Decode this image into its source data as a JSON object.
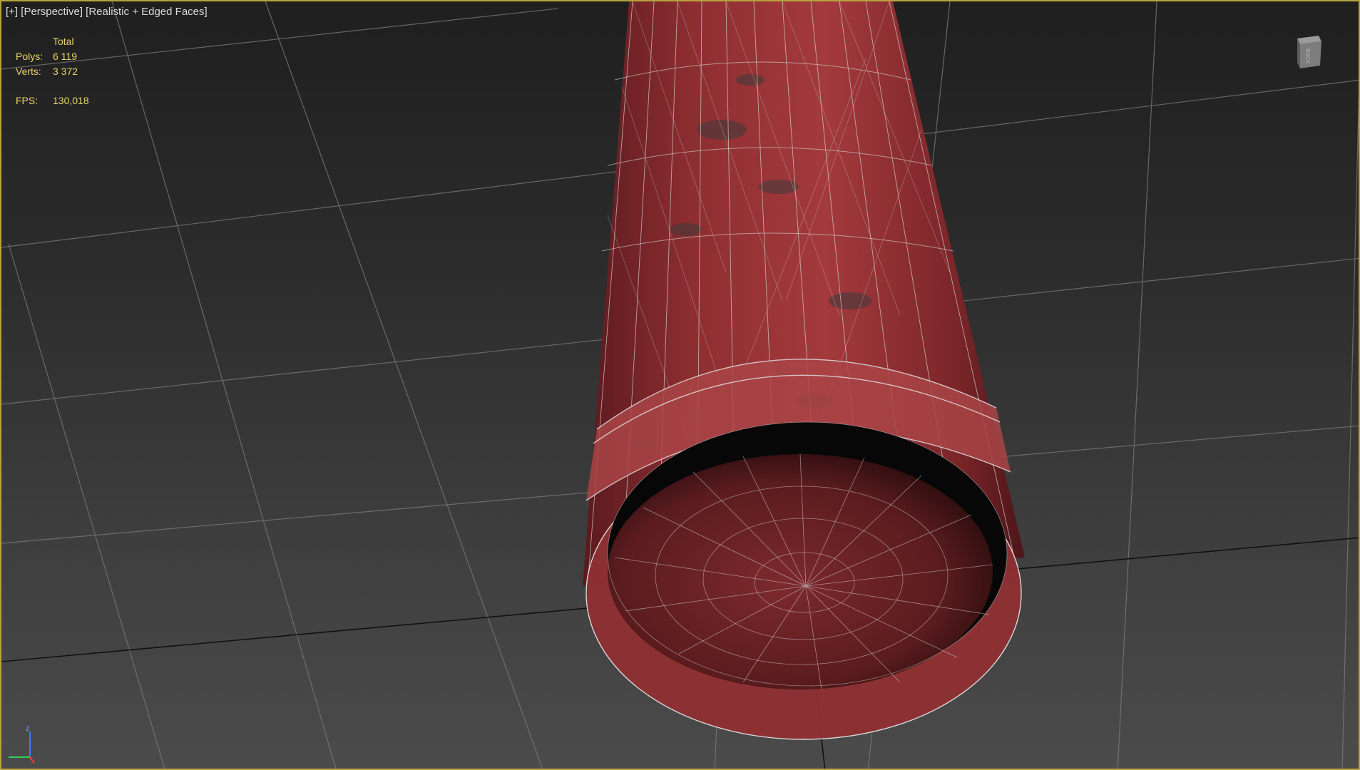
{
  "viewport": {
    "menu_plus": "[+]",
    "view_name": "[Perspective]",
    "shading_mode": "[Realistic + Edged Faces]",
    "border_color": "#b8a23c"
  },
  "stats": {
    "header": "Total",
    "polys_label": "Polys:",
    "polys_value": "6 119",
    "verts_label": "Verts:",
    "verts_value": "3 372",
    "fps_label": "FPS:",
    "fps_value": "130,018",
    "text_color": "#e8d36a"
  },
  "navigation": {
    "viewcube_icon": "viewcube-icon",
    "axis_icon": "axis-tripod-icon",
    "axis_z_label": "z"
  },
  "object": {
    "name_hint": "red cylinder",
    "material_color": "#8e2e31",
    "wire_color": "#d8d8d8"
  }
}
